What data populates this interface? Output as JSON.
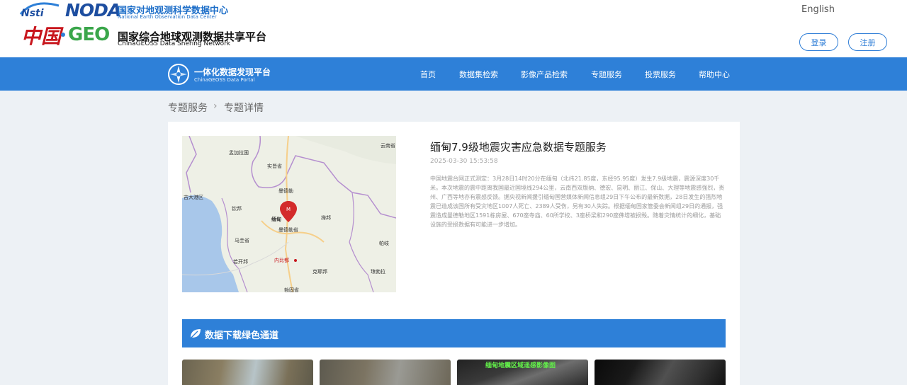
{
  "header": {
    "noda_brand": "NODA",
    "noda_name_cn": "国家对地观测科学数据中心",
    "noda_name_en": "National Earth Observation Data Center",
    "china_text": "中国",
    "geo_brand": "GEO",
    "geoss_name_cn": "国家综合地球观测数据共享平台",
    "geoss_name_en": "ChinaGEOSS Data Shering Network",
    "english_link": "English",
    "login_label": "登录",
    "register_label": "注册"
  },
  "nav": {
    "portal_cn": "一体化数据发现平台",
    "portal_en": "ChinaGEOSS Data Portal",
    "items": [
      "首页",
      "数据集检索",
      "影像产品检索",
      "专题服务",
      "投票服务",
      "帮助中心"
    ]
  },
  "breadcrumb": {
    "items": [
      "专题服务",
      "专题详情"
    ],
    "separator": "›"
  },
  "article": {
    "title": "缅甸7.9级地震灾害应急数据专题服务",
    "date": "2025-03-30 15:53:58",
    "body": "中国地震台网正式测定：3月28日14时20分在缅甸（北纬21.85度，东经95.95度）发生7.9级地震，震源深度30千米。本次地震的震中距离我国最近国境线294公里，云南西双版纳、德宏、昆明、丽江、保山、大理等地震感强烈，贵州、广西等地亦有震感反馈。据央视新闻援引缅甸国营媒体新闻信息组29日下午公布的最新数据，28日发生的强烈地震已造成该国所有受灾地区1007人死亡、2389人受伤，另有30人失踪。根据缅甸国家管委会新闻组29日的通报，强震造成曼德勒地区1591栋房屋、670座寺庙、60所学校、3座桥梁和290座佛塔被损毁。随着灾情统计的细化，基础设施的受损数据有可能进一步增加。"
  },
  "map": {
    "labels": [
      "孟加拉国",
      "云南省",
      "实皆省",
      "吉大港区",
      "钦邦",
      "曼德勒",
      "缅甸",
      "曼德勒省",
      "掸邦",
      "若开邦",
      "马圭省",
      "内比都",
      "克耶邦",
      "琅勃拉",
      "勃固省",
      "帕岐"
    ],
    "marker_letter": "M",
    "colors": {
      "water": "#a8c7ea",
      "land": "#eef0e6",
      "border": "#b58fcf",
      "road": "#f6cf8a",
      "marker": "#d32b2b"
    }
  },
  "green_channel": {
    "title": "数据下载绿色通道",
    "thumbnail_label": "缅甸地震区域遥感影像图"
  },
  "colors": {
    "primary_blue": "#2e80d8",
    "background": "#edf1f5",
    "china_red": "#c8161d",
    "geo_green": "#3aa64a"
  }
}
